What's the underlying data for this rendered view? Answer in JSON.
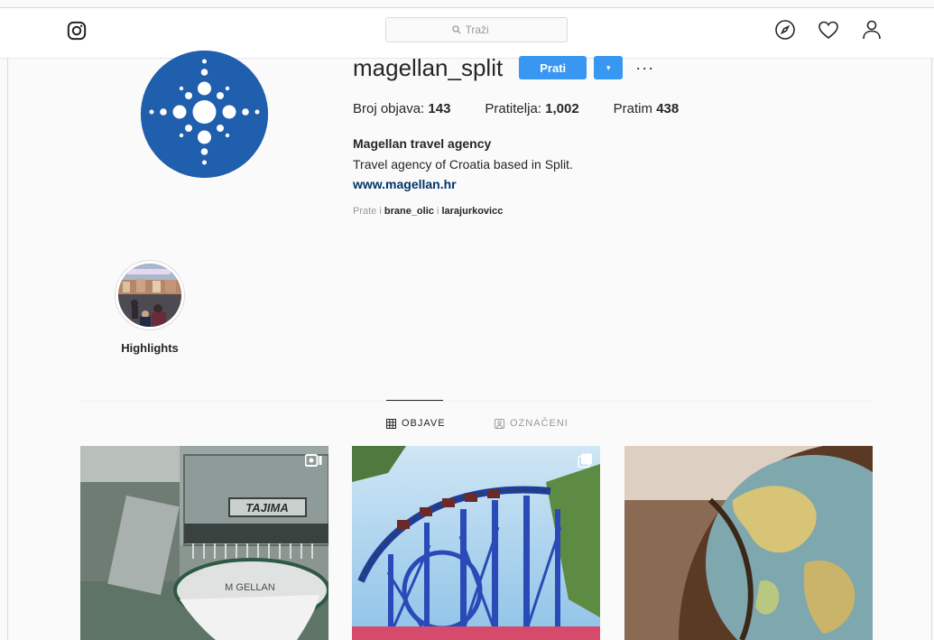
{
  "nav": {
    "search_placeholder": "Traži"
  },
  "profile": {
    "username": "magellan_split",
    "follow_label": "Prati",
    "dropdown_label": "▾",
    "more_label": "···",
    "stats": [
      {
        "label": "Broj objava:",
        "value": "143"
      },
      {
        "label": "Pratitelja:",
        "value": "1,002"
      },
      {
        "label": "Pratim",
        "value": "438"
      }
    ],
    "full_name": "Magellan travel agency",
    "bio": "Travel agency of Croatia based in Split.",
    "website": "www.magellan.hr",
    "followed_by_prefix": "Prate i",
    "followed_by_1": "brane_olic",
    "followed_by_joiner": "i",
    "followed_by_2": "larajurkovicc"
  },
  "highlights": [
    {
      "label": "Highlights"
    }
  ],
  "tabs": [
    {
      "label": "OBJAVE",
      "active": true
    },
    {
      "label": "OZNAČENI",
      "active": false
    }
  ],
  "posts": [
    {
      "image": "embroidery machine",
      "badge": "video-icon",
      "text": "TAJIMA",
      "patch_text": "M GELLAN"
    },
    {
      "image": "roller coaster",
      "badge": "multiple-posts-icon"
    },
    {
      "image": "globe",
      "badge": ""
    }
  ],
  "colors": {
    "accent": "#3897f0",
    "avatar_blue": "#1f5fad",
    "link": "#003569",
    "muted": "#999999"
  }
}
